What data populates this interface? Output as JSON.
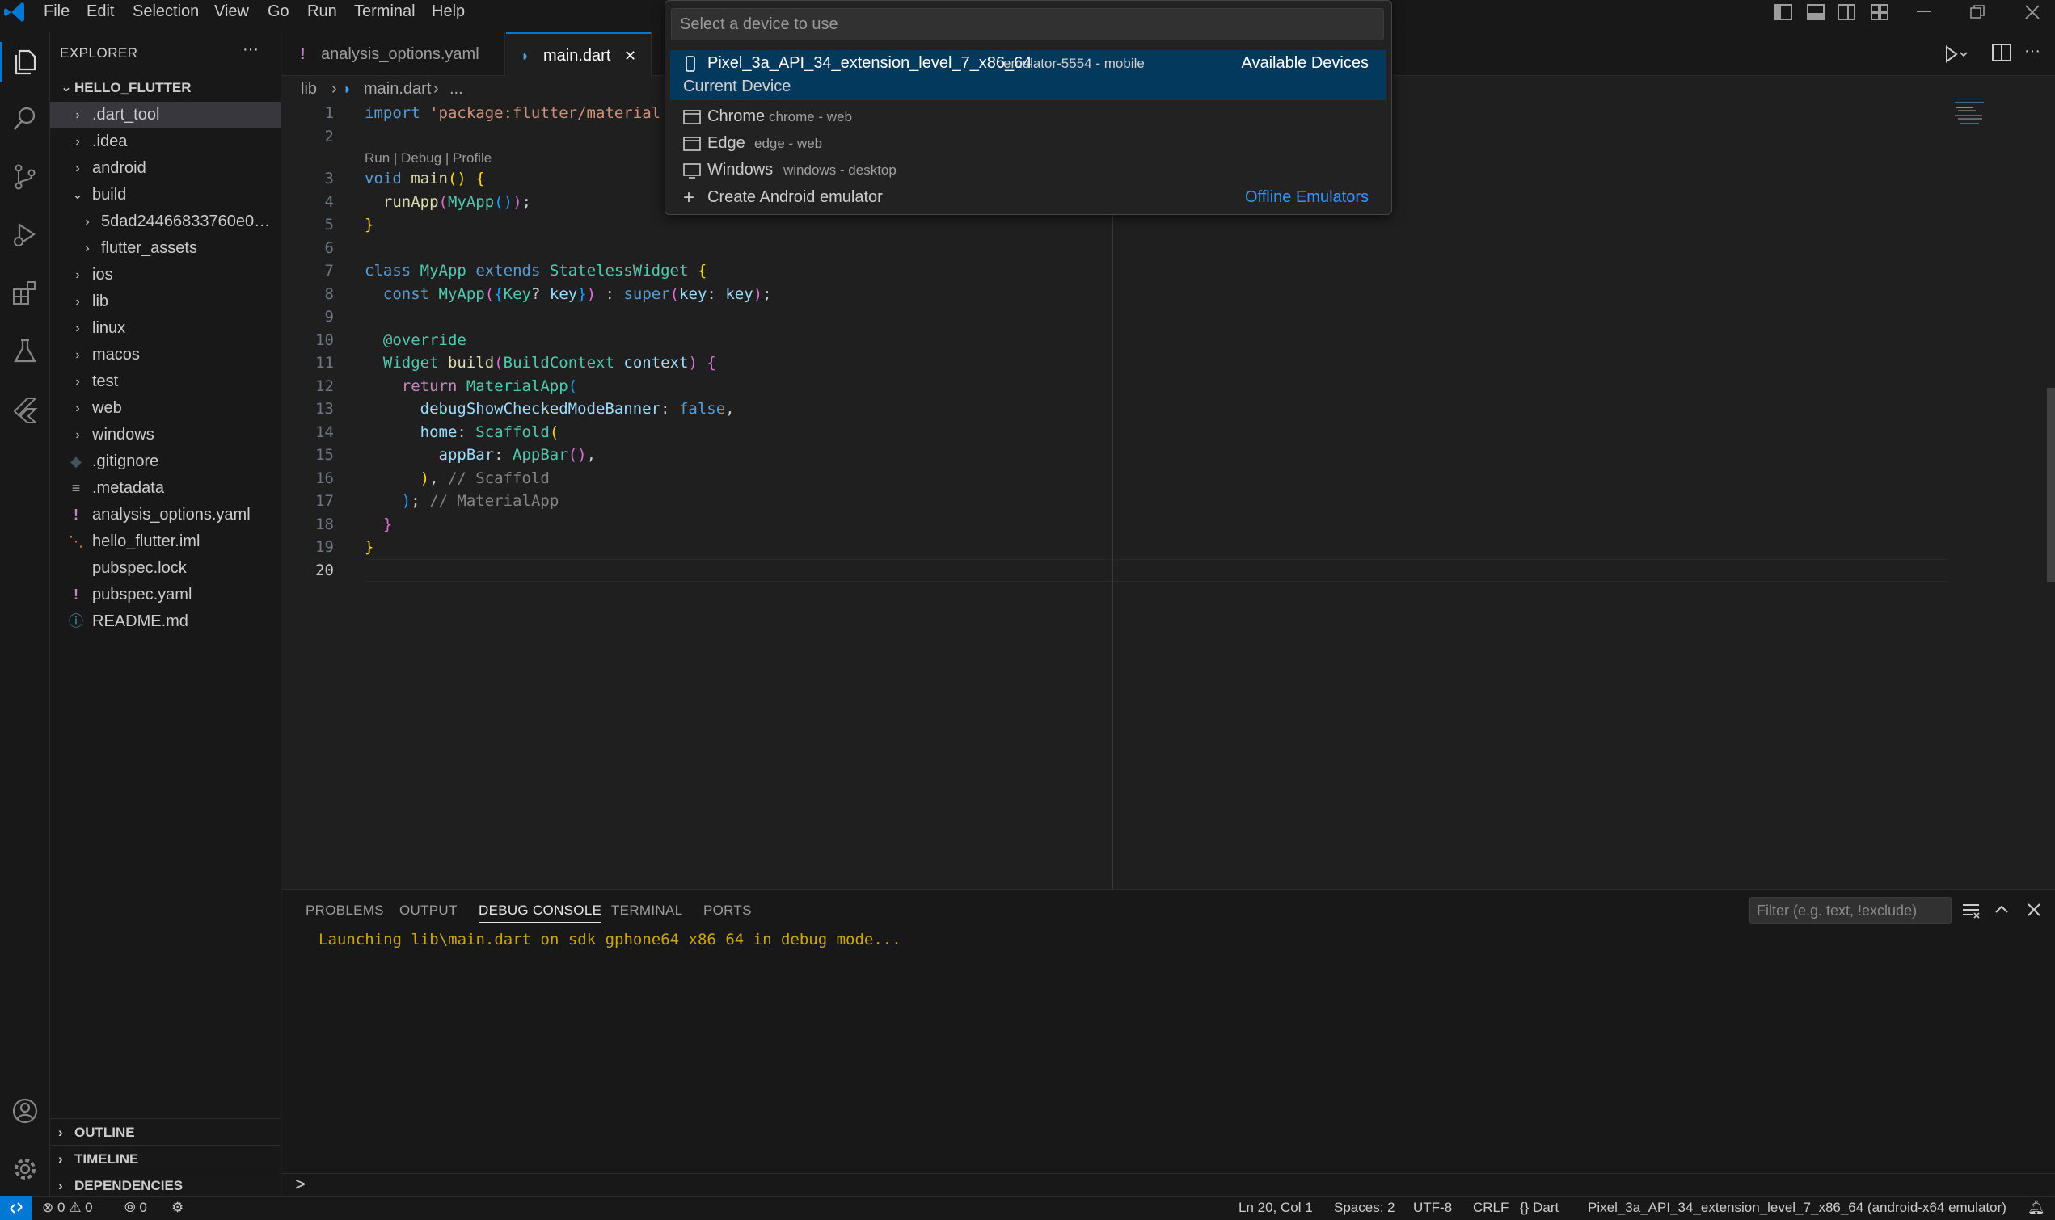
{
  "menu": [
    "File",
    "Edit",
    "Selection",
    "View",
    "Go",
    "Run",
    "Terminal",
    "Help"
  ],
  "explorer": {
    "title": "EXPLORER",
    "more": "···",
    "root": "HELLO_FLUTTER",
    "items": [
      {
        "label": ".dart_tool"
      },
      {
        "label": ".idea"
      },
      {
        "label": "android"
      },
      {
        "label": "build"
      },
      {
        "label": "5dad24466833760e037..."
      },
      {
        "label": "flutter_assets"
      },
      {
        "label": "ios"
      },
      {
        "label": "lib"
      },
      {
        "label": "linux"
      },
      {
        "label": "macos"
      },
      {
        "label": "test"
      },
      {
        "label": "web"
      },
      {
        "label": "windows"
      },
      {
        "label": ".gitignore"
      },
      {
        "label": ".metadata"
      },
      {
        "label": "analysis_options.yaml"
      },
      {
        "label": "hello_flutter.iml"
      },
      {
        "label": "pubspec.lock"
      },
      {
        "label": "pubspec.yaml"
      },
      {
        "label": "README.md"
      }
    ],
    "sections": [
      "OUTLINE",
      "TIMELINE",
      "DEPENDENCIES"
    ]
  },
  "tabs": [
    {
      "label": "analysis_options.yaml",
      "icon": "!"
    },
    {
      "label": "main.dart",
      "close": "✕"
    }
  ],
  "breadcrumb": {
    "lib": "lib",
    "file": "main.dart",
    "rest": "..."
  },
  "editor": {
    "codelens": "Run | Debug | Profile",
    "line_numbers": [
      "1",
      "2",
      "3",
      "4",
      "5",
      "6",
      "7",
      "8",
      "9",
      "10",
      "11",
      "12",
      "13",
      "14",
      "15",
      "16",
      "17",
      "18",
      "19",
      "20"
    ]
  },
  "quickpick": {
    "placeholder": "Select a device to use",
    "selected": {
      "name": "Pixel_3a_API_34_extension_level_7_x86_64",
      "desc": "emulator-5554 - mobile",
      "sub": "Current Device",
      "group": "Available Devices"
    },
    "items": [
      {
        "name": "Chrome",
        "desc": "chrome - web"
      },
      {
        "name": "Edge",
        "desc": "edge - web"
      },
      {
        "name": "Windows",
        "desc": "windows - desktop"
      }
    ],
    "create": {
      "name": "Create Android emulator",
      "group": "Offline Emulators"
    }
  },
  "panel": {
    "tabs": [
      "PROBLEMS",
      "OUTPUT",
      "DEBUG CONSOLE",
      "TERMINAL",
      "PORTS"
    ],
    "filter_placeholder": "Filter (e.g. text, !exclude)",
    "output": "Launching lib\\main.dart on sdk gphone64 x86 64 in debug mode...",
    "prompt": ">"
  },
  "status": {
    "errors": "0",
    "warnings": "0",
    "ports": "0",
    "position": "Ln 20, Col 1",
    "spaces": "Spaces: 2",
    "encoding": "UTF-8",
    "eol": "CRLF",
    "language": "Dart",
    "device": "Pixel_3a_API_34_extension_level_7_x86_64 (android-x64 emulator)"
  },
  "colors": {
    "accent": "#0078d4",
    "selection": "#04395e",
    "link": "#3794ff",
    "warning_text": "#cca700"
  }
}
